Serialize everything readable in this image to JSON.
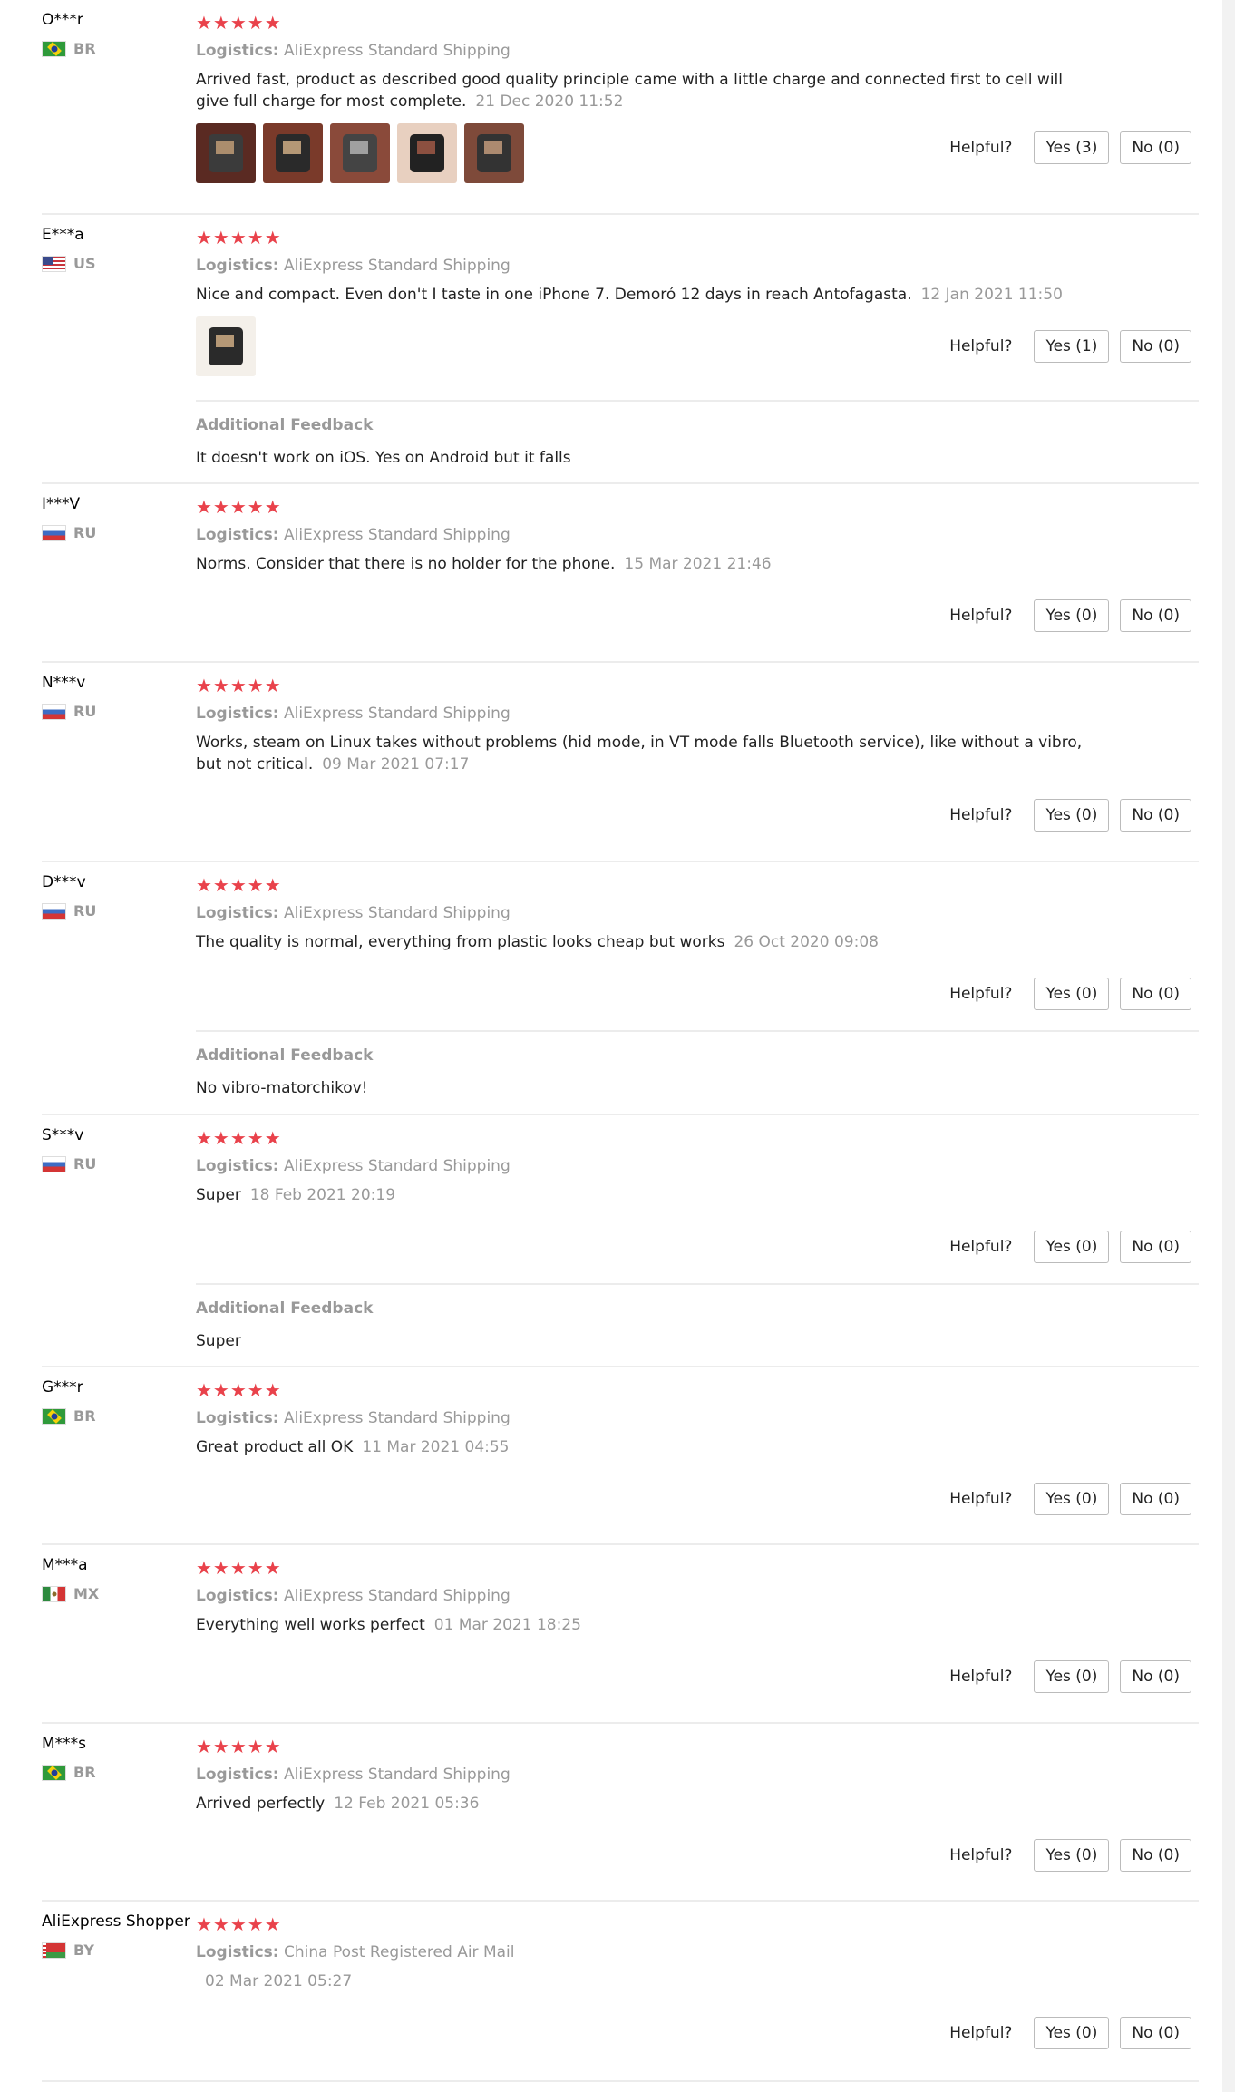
{
  "helpful_label": "Helpful?",
  "additional_label": "Additional Feedback",
  "logistics_label": "Logistics:",
  "stars": "★★★★★",
  "reviews": [
    {
      "user": "O***r",
      "country": "BR",
      "shipping": "AliExpress Standard Shipping",
      "text": "Arrived fast, product as described good quality principle came with a little charge and connected first to cell will give full charge for most complete.",
      "date": "21 Dec 2020 11:52",
      "yes": "Yes (3)",
      "no": "No (0)",
      "photos": 5
    },
    {
      "user": "E***a",
      "country": "US",
      "shipping": "AliExpress Standard Shipping",
      "text": "Nice and compact. Even don't I taste in one iPhone 7. Demoró 12 days in reach Antofagasta.",
      "date": "12 Jan 2021 11:50",
      "yes": "Yes (1)",
      "no": "No (0)",
      "photos": 1,
      "additional": "It doesn't work on iOS. Yes on Android but it falls"
    },
    {
      "user": "I***V",
      "country": "RU",
      "shipping": "AliExpress Standard Shipping",
      "text": "Norms. Consider that there is no holder for the phone.",
      "date": "15 Mar 2021 21:46",
      "yes": "Yes (0)",
      "no": "No (0)"
    },
    {
      "user": "N***v",
      "country": "RU",
      "shipping": "AliExpress Standard Shipping",
      "text": "Works, steam on Linux takes without problems (hid mode, in VT mode falls Bluetooth service), like without a vibro, but not critical.",
      "date": "09 Mar 2021 07:17",
      "yes": "Yes (0)",
      "no": "No (0)"
    },
    {
      "user": "D***v",
      "country": "RU",
      "shipping": "AliExpress Standard Shipping",
      "text": "The quality is normal, everything from plastic looks cheap but works",
      "date": "26 Oct 2020 09:08",
      "yes": "Yes (0)",
      "no": "No (0)",
      "additional": "No vibro-matorchikov!"
    },
    {
      "user": "S***v",
      "country": "RU",
      "shipping": "AliExpress Standard Shipping",
      "text": "Super",
      "date": "18 Feb 2021 20:19",
      "yes": "Yes (0)",
      "no": "No (0)",
      "additional": "Super"
    },
    {
      "user": "G***r",
      "country": "BR",
      "shipping": "AliExpress Standard Shipping",
      "text": "Great product all OK",
      "date": "11 Mar 2021 04:55",
      "yes": "Yes (0)",
      "no": "No (0)"
    },
    {
      "user": "M***a",
      "country": "MX",
      "shipping": "AliExpress Standard Shipping",
      "text": "Everything well works perfect",
      "date": "01 Mar 2021 18:25",
      "yes": "Yes (0)",
      "no": "No (0)"
    },
    {
      "user": "M***s",
      "country": "BR",
      "shipping": "AliExpress Standard Shipping",
      "text": "Arrived perfectly",
      "date": "12 Feb 2021 05:36",
      "yes": "Yes (0)",
      "no": "No (0)"
    },
    {
      "user": "AliExpress Shopper",
      "country": "BY",
      "shipping": "China Post Registered Air Mail",
      "text": "",
      "date": "02 Mar 2021 05:27",
      "yes": "Yes (0)",
      "no": "No (0)"
    }
  ]
}
